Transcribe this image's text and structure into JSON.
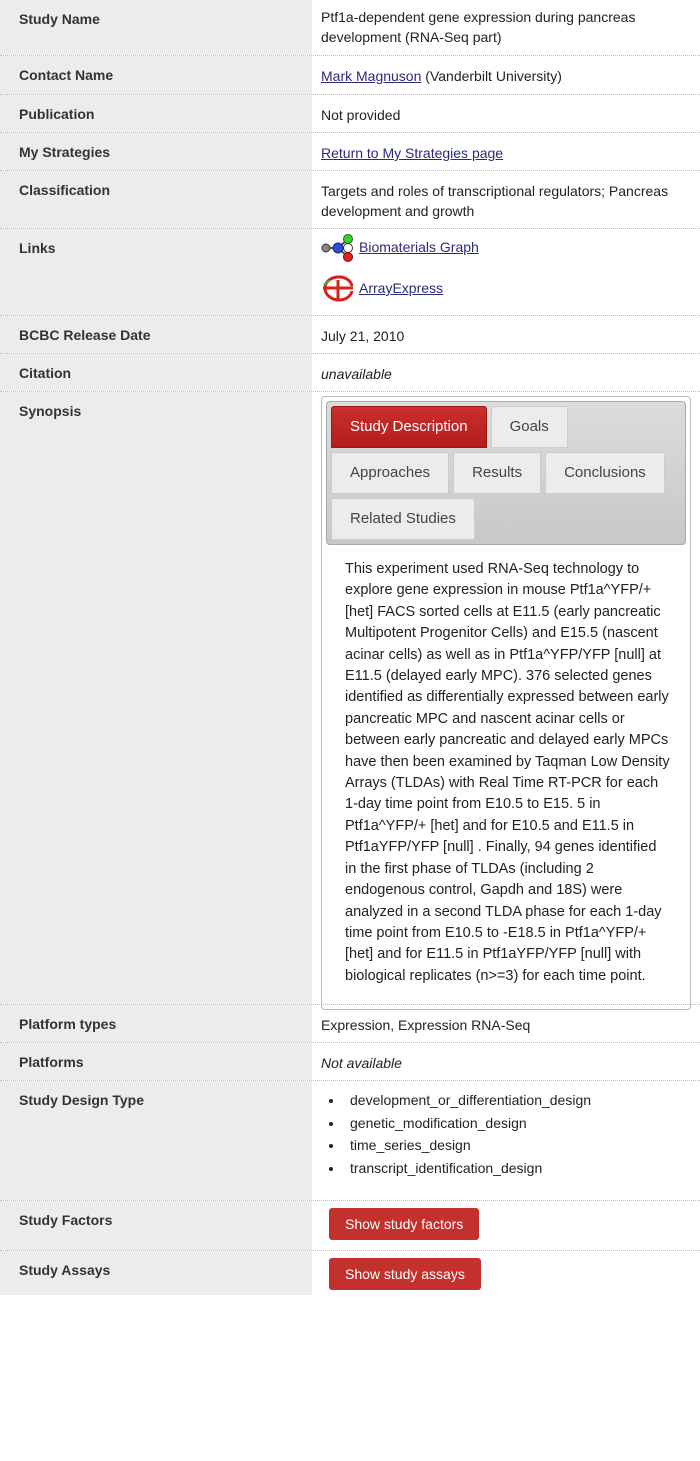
{
  "rows": {
    "study_name": {
      "label": "Study Name",
      "value": "Ptf1a-dependent gene expression during pancreas development (RNA-Seq part)"
    },
    "contact": {
      "label": "Contact Name",
      "name": "Mark Magnuson",
      "org": " (Vanderbilt University)"
    },
    "publication": {
      "label": "Publication",
      "value": "Not provided"
    },
    "strategies": {
      "label": "My Strategies",
      "link": "Return to My Strategies page"
    },
    "classification": {
      "label": "Classification",
      "value": "Targets and roles of transcriptional regulators; Pancreas development and growth"
    },
    "links": {
      "label": "Links",
      "biomaterials": "Biomaterials Graph",
      "arrayexpress": "ArrayExpress"
    },
    "release": {
      "label": "BCBC Release Date",
      "value": "July 21, 2010"
    },
    "citation": {
      "label": "Citation",
      "value": "unavailable"
    },
    "synopsis": {
      "label": "Synopsis",
      "tabs": [
        "Study Description",
        "Goals",
        "Approaches",
        "Results",
        "Conclusions",
        "Related Studies"
      ],
      "active_tab": "Study Description",
      "text": "This experiment used RNA-Seq technology to explore gene expression in mouse Ptf1a^YFP/+ [het] FACS sorted cells at E11.5 (early pancreatic Multipotent Progenitor Cells) and E15.5 (nascent acinar cells) as well as in Ptf1a^YFP/YFP [null] at E11.5 (delayed early MPC). 376 selected genes identified as differentially expressed between early pancreatic MPC and nascent acinar cells or between early pancreatic and delayed early MPCs have then been examined by Taqman Low Density Arrays (TLDAs) with Real Time RT-PCR for each 1-day time point from E10.5 to E15. 5 in Ptf1a^YFP/+ [het] and for E10.5 and E11.5 in Ptf1aYFP/YFP [null] . Finally, 94 genes identified in the first phase of TLDAs (including 2 endogenous control, Gapdh and 18S) were analyzed in a second TLDA phase for each 1-day time point from E10.5 to -E18.5 in Ptf1a^YFP/+ [het] and for E11.5 in Ptf1aYFP/YFP [null] with biological replicates (n>=3) for each time point."
    },
    "platform_types": {
      "label": "Platform types",
      "value": "Expression, Expression RNA-Seq"
    },
    "platforms": {
      "label": "Platforms",
      "value": "Not available"
    },
    "design": {
      "label": "Study Design Type",
      "items": [
        "development_or_differentiation_design",
        "genetic_modification_design",
        "time_series_design",
        "transcript_identification_design"
      ]
    },
    "factors": {
      "label": "Study Factors",
      "button": "Show study factors"
    },
    "assays": {
      "label": "Study Assays",
      "button": "Show study assays"
    }
  }
}
